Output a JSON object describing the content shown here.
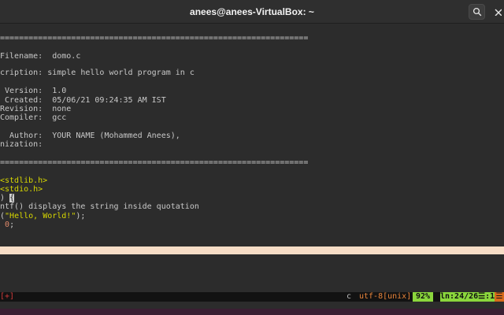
{
  "window": {
    "title": "anees@anees-VirtualBox: ~"
  },
  "icons": {
    "search": "search-icon",
    "close": "close-icon"
  },
  "editor": {
    "lines": [
      {
        "text": "=================================================================",
        "kind": "comment"
      },
      {
        "text": "",
        "kind": "comment"
      },
      {
        "text": "Filename:  domo.c",
        "kind": "comment"
      },
      {
        "text": "",
        "kind": "comment"
      },
      {
        "text": "cription: simple hello world program in c",
        "kind": "comment"
      },
      {
        "text": "",
        "kind": "comment"
      },
      {
        "text": " Version:  1.0",
        "kind": "comment"
      },
      {
        "text": " Created:  05/06/21 09:24:35 AM IST",
        "kind": "comment"
      },
      {
        "text": "Revision:  none",
        "kind": "comment"
      },
      {
        "text": "Compiler:  gcc",
        "kind": "comment"
      },
      {
        "text": "",
        "kind": "comment"
      },
      {
        "text": "  Author:  YOUR NAME (Mohammed Anees),",
        "kind": "comment"
      },
      {
        "text": "nization:",
        "kind": "comment"
      },
      {
        "text": "",
        "kind": "comment"
      },
      {
        "text": "=================================================================",
        "kind": "comment"
      },
      {
        "text": "",
        "kind": "comment"
      },
      {
        "text": "<stdlib.h>",
        "kind": "include"
      },
      {
        "text": "<stdio.h>",
        "kind": "include"
      }
    ],
    "main_line": {
      "paren": ")",
      "brace": "{"
    },
    "code_comment": "ntf() displays the string inside quotation",
    "printf_line": {
      "open": "(",
      "string": "\"Hello, World!\"",
      "close": ");"
    },
    "return_line": {
      "value": "0",
      "semi": ";"
    }
  },
  "statusline": {
    "modified": "[+]",
    "filetype": "c",
    "encoding": "utf-8[unix]",
    "percent": "92%",
    "position": "ln:24/26☰:1",
    "warning": "☰"
  },
  "colors": {
    "background": "#2c2c2c",
    "cursorline": "#f7ddc6",
    "statusline_green": "#8ad63c",
    "encoding_orange": "#e8843a",
    "include_yellow": "#d7d700"
  }
}
